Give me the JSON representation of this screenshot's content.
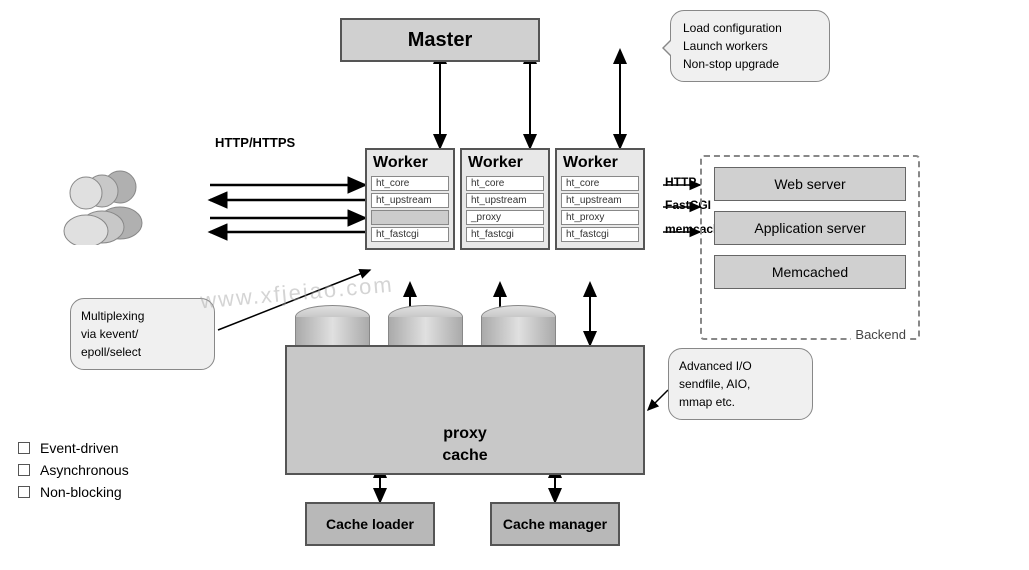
{
  "master": {
    "label": "Master"
  },
  "speechBubble": {
    "line1": "Load configuration",
    "line2": "Launch workers",
    "line3": "Non-stop upgrade"
  },
  "workers": [
    {
      "id": "worker1",
      "title": "Worker",
      "modules": [
        "ht_core",
        "ht_upstream",
        "",
        "ht_fastcgi"
      ]
    },
    {
      "id": "worker2",
      "title": "Worker",
      "modules": [
        "ht_core",
        "ht_upstream",
        "_proxy",
        "ht_fastcgi"
      ]
    },
    {
      "id": "worker3",
      "title": "Worker",
      "modules": [
        "ht_core",
        "ht_upstream",
        "ht_proxy",
        "ht_fastcgi"
      ]
    }
  ],
  "backend": {
    "label": "Backend",
    "items": [
      "Web server",
      "Application server",
      "Memcached"
    ]
  },
  "proxyCache": {
    "label": "proxy\ncache"
  },
  "cacheLoader": {
    "label": "Cache loader"
  },
  "cacheManager": {
    "label": "Cache manager"
  },
  "connectionLabels": {
    "http_https": "HTTP/HTTPS",
    "http": "HTTP",
    "fastcgi": "FastCGI",
    "memcache": "memcache"
  },
  "multiplexBubble": {
    "text": "Multiplexing\nvia kevent/\nepoll/select"
  },
  "advIOBubble": {
    "text": "Advanced I/O\nsendfile, AIO,\nmmap etc."
  },
  "legend": {
    "items": [
      "Event-driven",
      "Asynchronous",
      "Non-blocking"
    ]
  },
  "watermark": "www.xfjeiao.com"
}
